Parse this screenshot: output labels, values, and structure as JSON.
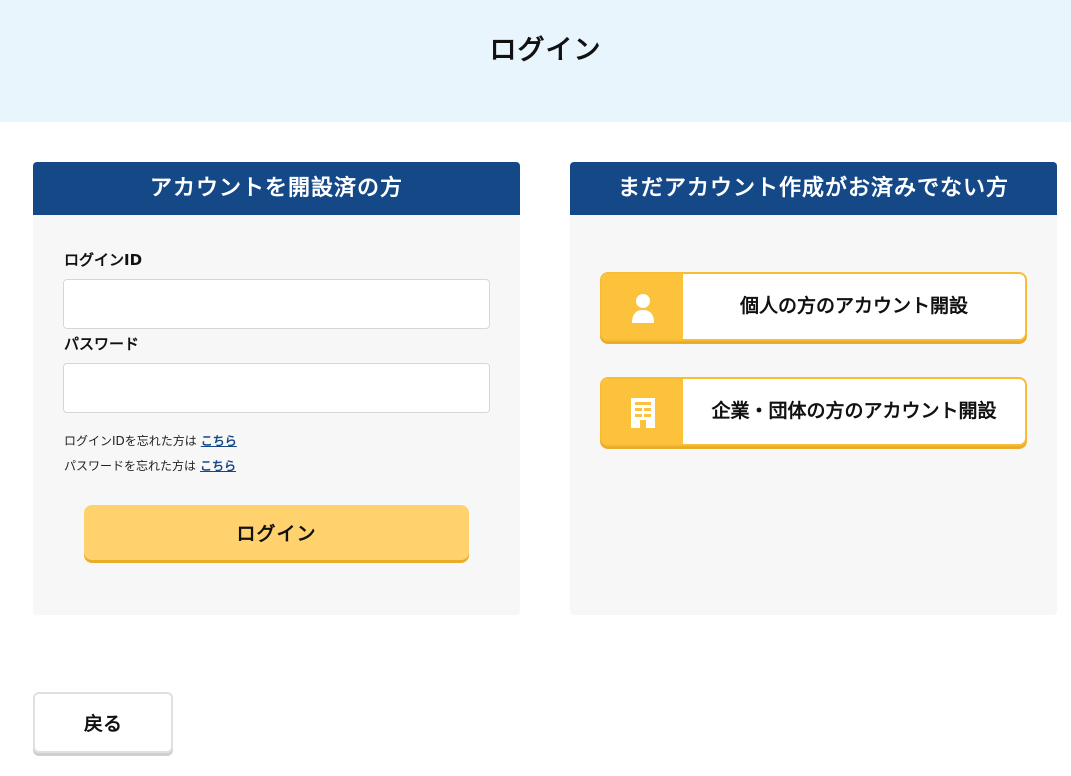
{
  "header": {
    "title": "ログイン"
  },
  "login_panel": {
    "heading": "アカウントを開設済の方",
    "login_id_label": "ログインID",
    "login_id_value": "",
    "password_label": "パスワード",
    "password_value": "",
    "forgot_id_text": "ログインIDを忘れた方は",
    "forgot_id_link": "こちら",
    "forgot_pw_text": "パスワードを忘れた方は",
    "forgot_pw_link": "こちら",
    "submit_label": "ログイン"
  },
  "signup_panel": {
    "heading": "まだアカウント作成がお済みでない方",
    "personal_label": "個人の方のアカウント開設",
    "personal_icon": "person-icon",
    "corporate_label": "企業・団体の方のアカウント開設",
    "corporate_icon": "building-icon"
  },
  "footer": {
    "back_label": "戻る"
  },
  "colors": {
    "header_bg": "#e8f5fd",
    "panel_head": "#144887",
    "accent_yellow": "#fdc23c",
    "login_button": "#ffd26e"
  }
}
